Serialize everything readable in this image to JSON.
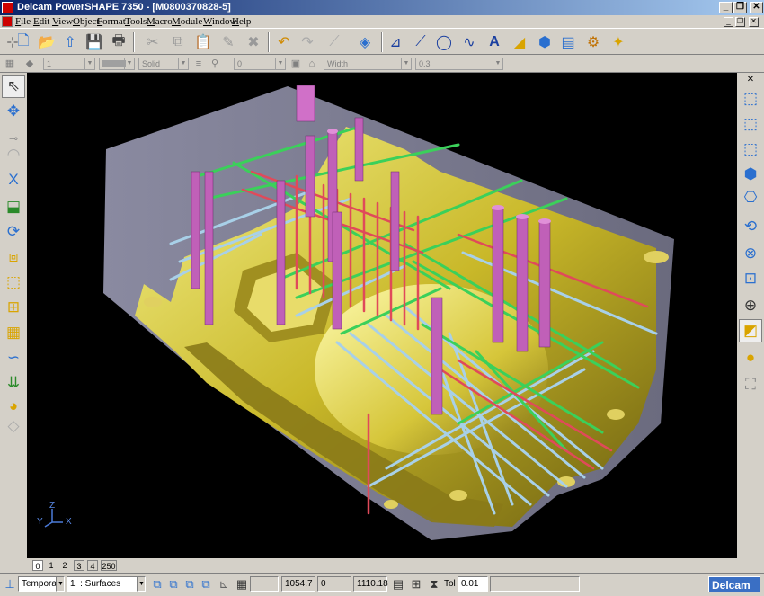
{
  "window": {
    "title": "Delcam PowerSHAPE 7350 - [M0800370828-5]",
    "controls": {
      "minimize": "_",
      "restore": "❐",
      "close": "✕"
    }
  },
  "menu": {
    "items": [
      {
        "u": "F",
        "rest": "ile"
      },
      {
        "u": "E",
        "rest": "dit"
      },
      {
        "u": "V",
        "rest": "iew"
      },
      {
        "u": "O",
        "rest": "bject"
      },
      {
        "u": "F",
        "rest": "ormat"
      },
      {
        "u": "T",
        "rest": "ools"
      },
      {
        "u": "M",
        "rest": "acro"
      },
      {
        "u": "M",
        "rest": "odule"
      },
      {
        "u": "W",
        "rest": "indow"
      },
      {
        "u": "H",
        "rest": "elp"
      }
    ]
  },
  "format_bar": {
    "level": "1",
    "line_style": "Solid",
    "width_value": "0",
    "material": "Width",
    "thickness": "0.3"
  },
  "viewport": {
    "axis": {
      "z": "Z",
      "y": "Y",
      "x": "X"
    },
    "background": "#000000"
  },
  "view_tabs": [
    "0",
    "1",
    "2",
    "3",
    "4",
    "250"
  ],
  "status": {
    "workplane": "Temporary",
    "level_number": "1",
    "level_name": ": Surfaces",
    "x": "1054.7",
    "y": "0",
    "z": "1110.18",
    "tol_label": "Tol",
    "tol_value": "0.01",
    "brand": "Delcam"
  }
}
